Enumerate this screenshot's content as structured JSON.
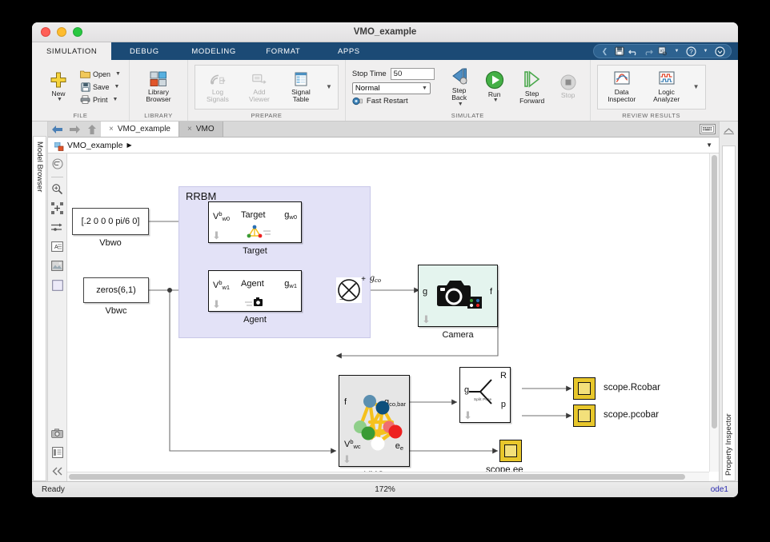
{
  "window": {
    "title": "VMO_example"
  },
  "ribbon": {
    "tabs": [
      {
        "label": "SIMULATION",
        "active": true
      },
      {
        "label": "DEBUG",
        "active": false
      },
      {
        "label": "MODELING",
        "active": false
      },
      {
        "label": "FORMAT",
        "active": false
      },
      {
        "label": "APPS",
        "active": false
      }
    ],
    "quick_access": [
      "save-icon",
      "undo-icon",
      "redo-icon",
      "find-icon",
      "chevron-down-icon",
      "help-icon",
      "chevron-down-icon",
      "notify-icon"
    ],
    "groups": {
      "file": {
        "label": "FILE",
        "new_label": "New",
        "items": [
          {
            "label": "Open",
            "icon": "folder-icon"
          },
          {
            "label": "Save",
            "icon": "floppy-icon"
          },
          {
            "label": "Print",
            "icon": "printer-icon"
          }
        ]
      },
      "library": {
        "label": "LIBRARY",
        "browser_label": "Library\nBrowser",
        "browser_line1": "Library",
        "browser_line2": "Browser"
      },
      "prepare": {
        "label": "PREPARE",
        "items": [
          {
            "line1": "Log",
            "line2": "Signals",
            "icon": "log-signals-icon",
            "disabled": true
          },
          {
            "line1": "Add",
            "line2": "Viewer",
            "icon": "add-viewer-icon",
            "disabled": true
          },
          {
            "line1": "Signal",
            "line2": "Table",
            "icon": "signal-table-icon",
            "disabled": false
          }
        ]
      },
      "simulate": {
        "label": "SIMULATE",
        "stop_time_label": "Stop Time",
        "stop_time_value": "50",
        "mode_value": "Normal",
        "fast_restart_label": "Fast Restart",
        "buttons": [
          {
            "line1": "Step",
            "line2": "Back",
            "icon": "step-back-icon",
            "disabled": false,
            "has_caret": true
          },
          {
            "line1": "Run",
            "line2": "",
            "icon": "run-icon",
            "disabled": false,
            "has_caret": true
          },
          {
            "line1": "Step",
            "line2": "Forward",
            "icon": "step-forward-icon",
            "disabled": false,
            "has_caret": false
          },
          {
            "line1": "Stop",
            "line2": "",
            "icon": "stop-icon",
            "disabled": true,
            "has_caret": false
          }
        ]
      },
      "review": {
        "label": "REVIEW RESULTS",
        "items": [
          {
            "line1": "Data",
            "line2": "Inspector",
            "icon": "data-inspector-icon"
          },
          {
            "line1": "Logic",
            "line2": "Analyzer",
            "icon": "logic-analyzer-icon"
          }
        ]
      }
    }
  },
  "panels": {
    "left_tab": "Model Browser",
    "right_tab": "Property Inspector"
  },
  "navbar": {
    "back_icon": "back-arrow-icon",
    "forward_icon": "forward-arrow-icon",
    "up_icon": "up-arrow-icon",
    "tabs": [
      {
        "label": "VMO_example",
        "active": true
      },
      {
        "label": "VMO",
        "active": false
      }
    ]
  },
  "breadcrumb": {
    "icon": "model-icon",
    "text": "VMO_example",
    "arrow": "▶",
    "dropdown": "▼"
  },
  "palette": {
    "tools": [
      "navigate-up-icon",
      "zoom-icon",
      "fit-to-view-icon",
      "signal-routing-icon",
      "annotation-icon",
      "image-icon",
      "area-icon",
      "camera-icon",
      "report-icon",
      "collapse-icon"
    ]
  },
  "diagram": {
    "group": {
      "label": "RRBM"
    },
    "constants": [
      {
        "value": "[.2 0 0 0 pi/6 0]",
        "name": "Vbwo"
      },
      {
        "value": "zeros(6,1)",
        "name": "Vbwc"
      }
    ],
    "blocks": [
      {
        "name": "Target",
        "title": "Target",
        "caption": "Target",
        "in_port": "V",
        "in_sup": "b",
        "in_sub": "w0",
        "out_port": "g",
        "out_sub": "w0",
        "icon": "graph-icon"
      },
      {
        "name": "Agent",
        "title": "Agent",
        "caption": "Agent",
        "in_port": "V",
        "in_sup": "b",
        "in_sub": "w1",
        "out_port": "g",
        "out_sub": "w1",
        "icon": "camera-icon"
      },
      {
        "name": "Camera",
        "caption": "Camera",
        "in_port": "g",
        "out_port": "f",
        "icon": "camera-icon"
      },
      {
        "name": "VMO",
        "caption": "VMO",
        "in_port_1": "f",
        "in_port_2": "V",
        "in_sup_2": "b",
        "in_sub_2": "wc",
        "out_port_1": "g",
        "out_sub_1": "co,bar",
        "out_port_2": "e",
        "out_sub_2": "e",
        "icon": "graph-nodes-icon"
      },
      {
        "name": "Split Pose",
        "caption": "",
        "label": "Split Pose",
        "in_port": "g",
        "out_port_1": "R",
        "out_port_2": "p"
      }
    ],
    "product_block": {
      "name": "product",
      "sign_top": "+",
      "sign_left": "−"
    },
    "signal_labels": [
      {
        "text": "g",
        "sub": "co"
      }
    ],
    "scopes": [
      {
        "name": "scope.Rcobar",
        "label": "scope.Rcobar"
      },
      {
        "name": "scope.pcobar",
        "label": "scope.pcobar"
      },
      {
        "name": "scope.ee",
        "label": "scope.ee"
      }
    ],
    "node_colors": [
      "#5b8fb0",
      "#0d4f7c",
      "#8fcf8a",
      "#3a9b35",
      "#ffffff",
      "#ee2020",
      "#f06f6f"
    ],
    "edge_color": "#f5c11e"
  },
  "status": {
    "left": "Ready",
    "zoom": "172%",
    "solver": "ode1"
  }
}
